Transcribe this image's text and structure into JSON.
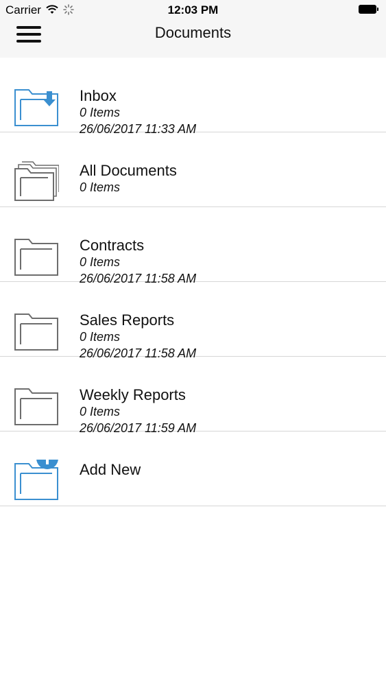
{
  "status": {
    "carrier": "Carrier",
    "time": "12:03 PM"
  },
  "nav": {
    "title": "Documents",
    "menu_icon": "hamburger-menu-icon"
  },
  "folders": [
    {
      "name": "Inbox",
      "count": "0 Items",
      "date": "26/06/2017 11:33 AM",
      "icon": "inbox-folder-icon",
      "color": "#3a8fd0"
    },
    {
      "name": "All Documents",
      "count": "0 Items",
      "date": "",
      "icon": "all-documents-folder-icon",
      "color": "#6d6d6d"
    },
    {
      "name": "Contracts",
      "count": "0 Items",
      "date": "26/06/2017 11:58 AM",
      "icon": "folder-icon",
      "color": "#6d6d6d"
    },
    {
      "name": "Sales Reports",
      "count": "0 Items",
      "date": "26/06/2017 11:58 AM",
      "icon": "folder-icon",
      "color": "#6d6d6d"
    },
    {
      "name": "Weekly Reports",
      "count": "0 Items",
      "date": "26/06/2017 11:59 AM",
      "icon": "folder-icon",
      "color": "#6d6d6d"
    },
    {
      "name": "Add New",
      "count": "",
      "date": "",
      "icon": "add-folder-icon",
      "color": "#3a8fd0"
    }
  ]
}
